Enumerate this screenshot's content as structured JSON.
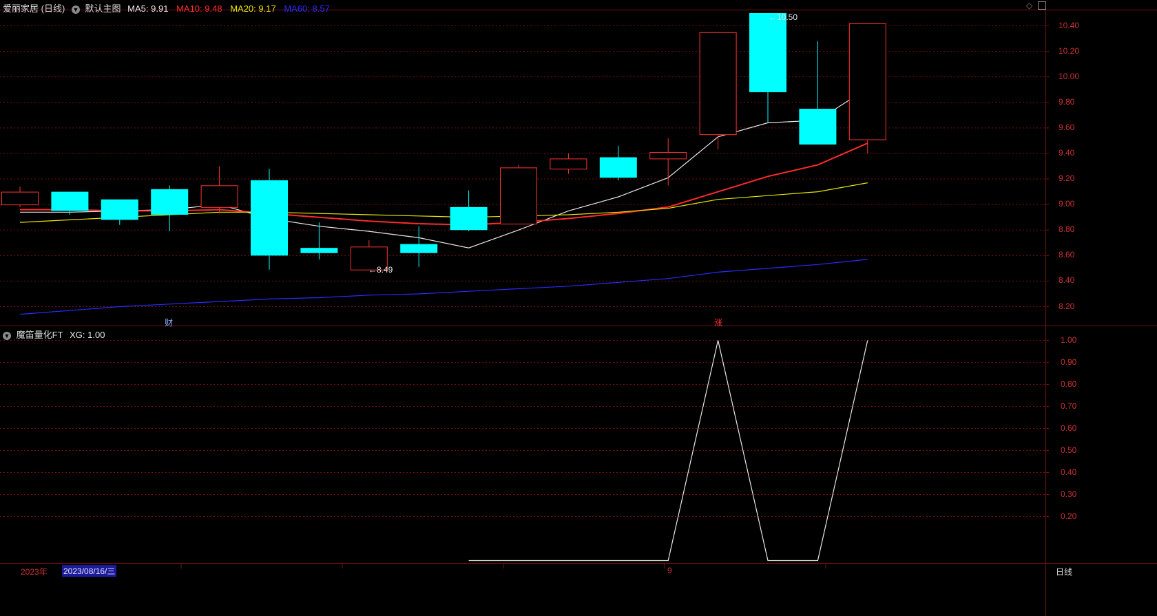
{
  "header": {
    "stock_name": "爱丽家居 (日线)",
    "main_chart": "默认主图",
    "ma": [
      {
        "label": "MA5: 9.91",
        "color": "#e8e8e8"
      },
      {
        "label": "MA10: 9.48",
        "color": "#ff2a2a"
      },
      {
        "label": "MA20: 9.17",
        "color": "#e8e800"
      },
      {
        "label": "MA60: 8.57",
        "color": "#2a2aff"
      }
    ]
  },
  "indicator_header": {
    "name": "魔笛量化FT",
    "value": "XG: 1.00"
  },
  "time_axis": {
    "year_label": "2023年",
    "cursor_date": "2023/08/16/三",
    "month_label": "9",
    "period_label": "日线"
  },
  "annotations": {
    "high_label": "10.50",
    "low_label": "8.49",
    "event_markers": [
      {
        "text": "财",
        "index": 3,
        "color": "#8fb4ff"
      },
      {
        "text": "涨",
        "index": 14,
        "color": "#ff3030"
      }
    ]
  },
  "colors": {
    "up": "#ff3232",
    "down": "#00ffff",
    "grid": "#7a1010",
    "axis_text": "#c83232"
  },
  "chart_data": [
    {
      "type": "candlestick",
      "title": "爱丽家居 (日线)",
      "ylim": [
        8.08,
        10.5
      ],
      "yticks": [
        "10.40",
        "10.20",
        "10.00",
        "9.80",
        "9.60",
        "9.40",
        "9.20",
        "9.00",
        "8.80",
        "8.60",
        "8.40",
        "8.20"
      ],
      "candles": [
        {
          "open": 9.0,
          "high": 9.14,
          "low": 8.98,
          "close": 9.1
        },
        {
          "open": 9.1,
          "high": 9.1,
          "low": 8.92,
          "close": 8.95
        },
        {
          "open": 9.04,
          "high": 9.04,
          "low": 8.84,
          "close": 8.88
        },
        {
          "open": 9.12,
          "high": 9.15,
          "low": 8.79,
          "close": 8.92
        },
        {
          "open": 8.98,
          "high": 9.3,
          "low": 8.93,
          "close": 9.15
        },
        {
          "open": 9.19,
          "high": 9.28,
          "low": 8.49,
          "close": 8.6
        },
        {
          "open": 8.66,
          "high": 8.86,
          "low": 8.57,
          "close": 8.62
        },
        {
          "open": 8.49,
          "high": 8.72,
          "low": 8.49,
          "close": 8.67
        },
        {
          "open": 8.69,
          "high": 8.83,
          "low": 8.51,
          "close": 8.62
        },
        {
          "open": 8.98,
          "high": 9.11,
          "low": 8.79,
          "close": 8.8
        },
        {
          "open": 8.85,
          "high": 9.31,
          "low": 8.85,
          "close": 9.29
        },
        {
          "open": 9.28,
          "high": 9.4,
          "low": 9.24,
          "close": 9.36
        },
        {
          "open": 9.37,
          "high": 9.46,
          "low": 9.19,
          "close": 9.21
        },
        {
          "open": 9.36,
          "high": 9.52,
          "low": 9.15,
          "close": 9.41
        },
        {
          "open": 9.55,
          "high": 9.55,
          "low": 9.43,
          "close": 10.35
        },
        {
          "open": 10.5,
          "high": 10.5,
          "low": 9.64,
          "close": 9.88
        },
        {
          "open": 9.75,
          "high": 10.28,
          "low": 9.47,
          "close": 9.47
        },
        {
          "open": 9.51,
          "high": 10.42,
          "low": 9.4,
          "close": 10.42
        }
      ],
      "series": [
        {
          "name": "MA5",
          "color": "#e8e8e8",
          "values": [
            8.94,
            8.94,
            8.95,
            8.96,
            9.0,
            8.89,
            8.83,
            8.79,
            8.74,
            8.66,
            8.8,
            8.95,
            9.06,
            9.21,
            9.53,
            9.64,
            9.66,
            9.91
          ]
        },
        {
          "name": "MA10",
          "color": "#ff2a2a",
          "values": [
            8.96,
            8.96,
            8.95,
            8.95,
            8.96,
            8.93,
            8.9,
            8.87,
            8.85,
            8.84,
            8.86,
            8.89,
            8.93,
            8.98,
            9.1,
            9.22,
            9.31,
            9.48
          ]
        },
        {
          "name": "MA20",
          "color": "#e8e800",
          "values": [
            8.86,
            8.88,
            8.9,
            8.92,
            8.94,
            8.94,
            8.93,
            8.92,
            8.91,
            8.9,
            8.91,
            8.92,
            8.94,
            8.97,
            9.04,
            9.07,
            9.1,
            9.17
          ]
        },
        {
          "name": "MA60",
          "color": "#2a2aff",
          "values": [
            8.14,
            8.17,
            8.2,
            8.22,
            8.24,
            8.26,
            8.27,
            8.29,
            8.3,
            8.32,
            8.34,
            8.36,
            8.39,
            8.42,
            8.47,
            8.5,
            8.53,
            8.57
          ]
        }
      ]
    },
    {
      "type": "line",
      "title": "魔笛量化FT",
      "ylim": [
        0,
        1.0
      ],
      "yticks": [
        "1.00",
        "0.90",
        "0.80",
        "0.70",
        "0.60",
        "0.50",
        "0.40",
        "0.30",
        "0.20"
      ],
      "series": [
        {
          "name": "XG",
          "color": "#e8e8e8",
          "start_index": 9,
          "values": [
            0,
            0,
            0,
            0,
            0,
            1,
            0,
            0,
            1
          ]
        }
      ]
    }
  ]
}
